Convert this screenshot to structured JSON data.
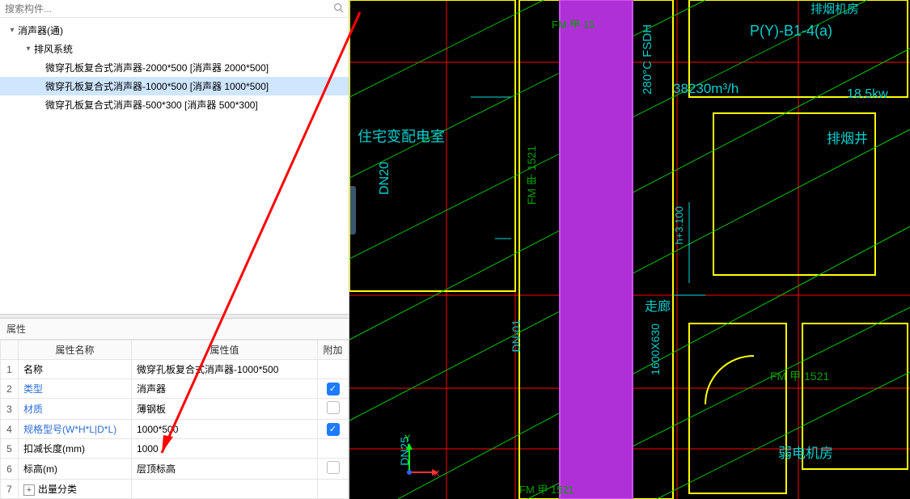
{
  "search": {
    "placeholder": "搜索构件..."
  },
  "tree": {
    "root": {
      "label": "消声器(通)"
    },
    "child1": {
      "label": "排风系统"
    },
    "items": [
      {
        "label": "微穿孔板复合式消声器-2000*500 [消声器 2000*500]"
      },
      {
        "label": "微穿孔板复合式消声器-1000*500 [消声器 1000*500]"
      },
      {
        "label": "微穿孔板复合式消声器-500*300 [消声器 500*300]"
      }
    ]
  },
  "props": {
    "title": "属性",
    "headers": {
      "name": "属性名称",
      "value": "属性值",
      "attach": "附加"
    },
    "rows": [
      {
        "idx": "1",
        "name": "名称",
        "value": "微穿孔板复合式消声器-1000*500",
        "link": false,
        "attach": null
      },
      {
        "idx": "2",
        "name": "类型",
        "value": "消声器",
        "link": true,
        "attach": true
      },
      {
        "idx": "3",
        "name": "材质",
        "value": "薄钢板",
        "link": true,
        "attach": false
      },
      {
        "idx": "4",
        "name": "规格型号(W*H*L|D*L)",
        "value": "1000*500",
        "link": true,
        "attach": true
      },
      {
        "idx": "5",
        "name": "扣减长度(mm)",
        "value": "1000",
        "link": false,
        "attach": null
      },
      {
        "idx": "6",
        "name": "标高(m)",
        "value": "层顶标高",
        "link": false,
        "attach": false
      },
      {
        "idx": "7",
        "name": "出量分类",
        "value": "",
        "link": false,
        "attach": null,
        "expand": true
      }
    ]
  },
  "cad": {
    "labels": {
      "room1": "住宅变配电室",
      "dn20": "DN20",
      "fm1": "FM 甲 1521",
      "fm_top": "FM 甲 15",
      "temp": "280°C FSDH",
      "flow": "38230m³/h",
      "power": "18.5kw",
      "fanroom": "排烟机房",
      "pcode": "P(Y)-B1-4(a)",
      "shaft": "排烟井",
      "corridor": "走廊",
      "dn01": "DN-01",
      "dn25": "DN25",
      "size": "1600X630",
      "height": "h+3.100",
      "fm2": "FM 甲 1521",
      "fm3": "FM 甲 1521",
      "room2": "弱电机房",
      "axis_y": "Y",
      "axis_x": "X"
    }
  }
}
